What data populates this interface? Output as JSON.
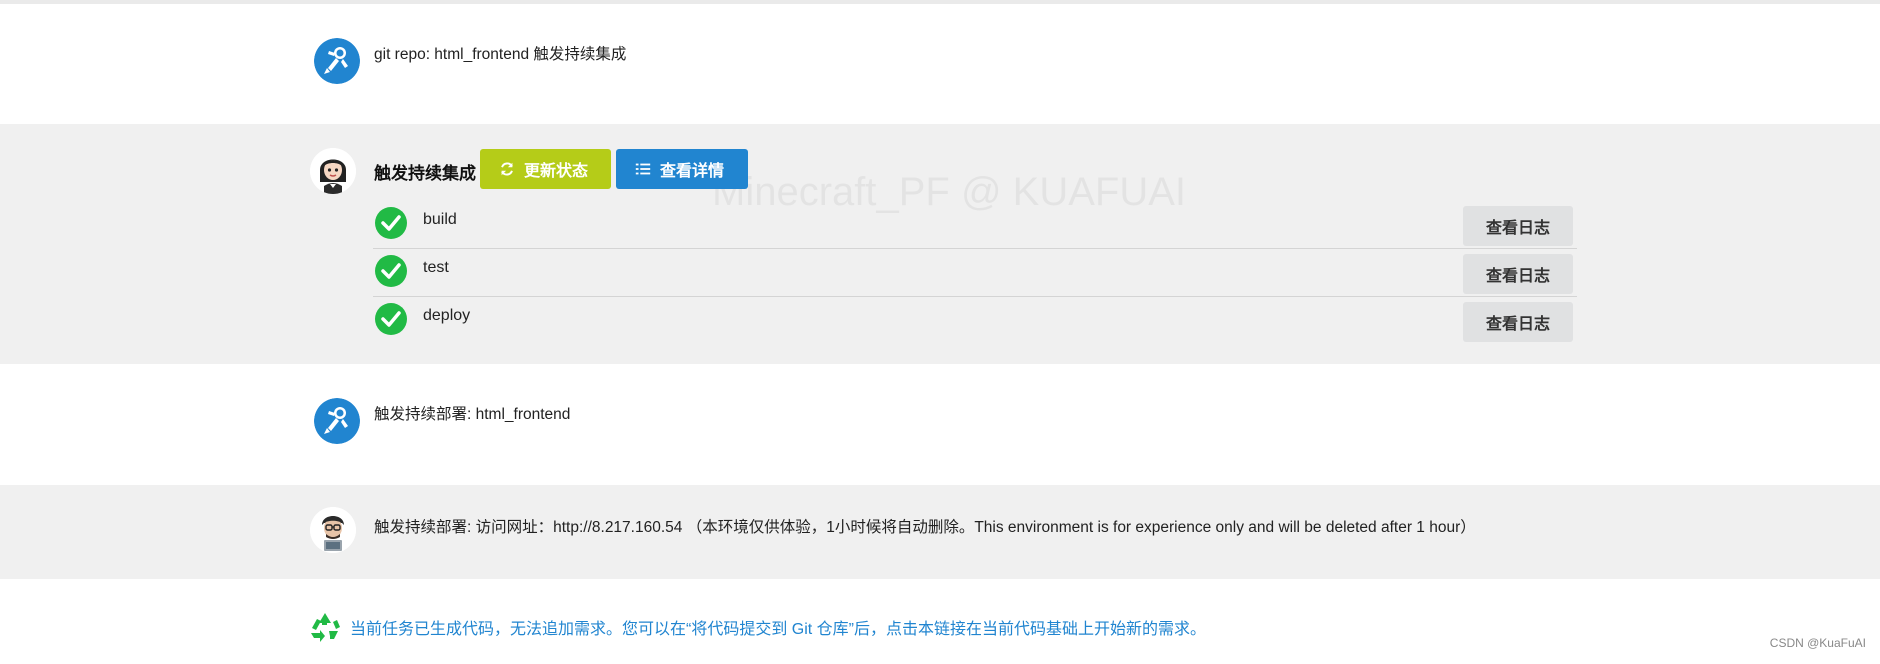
{
  "watermark": "Minecraft_PF @ KUAFUAI",
  "messages": [
    {
      "text": "git repo: html_frontend 触发持续集成"
    },
    {
      "title": "触发持续集成",
      "buttons": {
        "refresh_label": "更新状态",
        "details_label": "查看详情"
      },
      "steps": [
        {
          "name": "build",
          "status": "success",
          "log_label": "查看日志"
        },
        {
          "name": "test",
          "status": "success",
          "log_label": "查看日志"
        },
        {
          "name": "deploy",
          "status": "success",
          "log_label": "查看日志"
        }
      ]
    },
    {
      "text": "触发持续部署: html_frontend"
    },
    {
      "text": "触发持续部署: 访问网址：http://8.217.160.54 （本环境仅供体验，1小时候将自动删除。This environment is for experience only and will be deleted after 1 hour）"
    }
  ],
  "notice": "当前任务已生成代码，无法追加需求。您可以在“将代码提交到 Git 仓库”后，点击本链接在当前代码基础上开始新的需求。",
  "footer": "CSDN @KuaFuAI",
  "colors": {
    "accent_blue": "#2185d0",
    "accent_green": "#b5cc18",
    "success": "#21ba45",
    "band_gray": "#f0f0f0"
  },
  "icons": {
    "bot_avatar": "astronaut-icon",
    "user_female_avatar": "woman-avatar-icon",
    "user_male_avatar": "man-avatar-icon",
    "refresh": "refresh-icon",
    "details": "list-icon",
    "step_status": "check-circle-icon",
    "notice": "recycle-icon"
  }
}
